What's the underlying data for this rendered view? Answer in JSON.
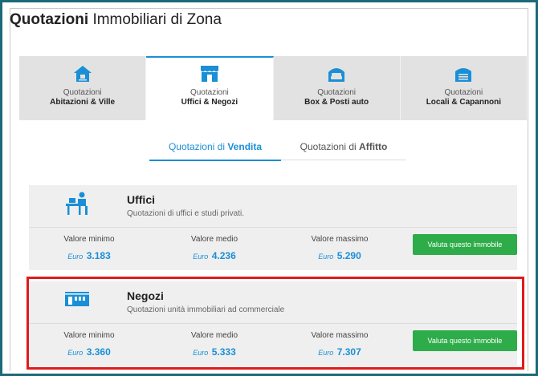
{
  "page": {
    "title_bold": "Quotazioni",
    "title_rest": "Immobiliari di Zona"
  },
  "category_tabs": [
    {
      "line1": "Quotazioni",
      "line2": "Abitazioni & Ville",
      "icon": "house-icon",
      "active": false
    },
    {
      "line1": "Quotazioni",
      "line2": "Uffici & Negozi",
      "icon": "shop-icon",
      "active": true
    },
    {
      "line1": "Quotazioni",
      "line2": "Box & Posti auto",
      "icon": "car-garage-icon",
      "active": false
    },
    {
      "line1": "Quotazioni",
      "line2": "Locali & Capannoni",
      "icon": "warehouse-icon",
      "active": false
    }
  ],
  "sub_tabs": {
    "vendita_prefix": "Quotazioni di",
    "vendita_bold": "Vendita",
    "affitto_prefix": "Quotazioni di",
    "affitto_bold": "Affitto"
  },
  "cards": [
    {
      "title": "Uffici",
      "description": "Quotazioni di uffici e studi privati.",
      "icon": "office-desk-icon",
      "min_label": "Valore minimo",
      "min_currency": "Euro",
      "min_value": "3.183",
      "avg_label": "Valore medio",
      "avg_currency": "Euro",
      "avg_value": "4.236",
      "max_label": "Valore massimo",
      "max_currency": "Euro",
      "max_value": "5.290",
      "button": "Valuta questo immobile"
    },
    {
      "title": "Negozi",
      "description": "Quotazioni unità immobiliari ad commerciale",
      "icon": "storefront-icon",
      "min_label": "Valore minimo",
      "min_currency": "Euro",
      "min_value": "3.360",
      "avg_label": "Valore medio",
      "avg_currency": "Euro",
      "avg_value": "5.333",
      "max_label": "Valore massimo",
      "max_currency": "Euro",
      "max_value": "7.307",
      "button": "Valuta questo immobile"
    }
  ],
  "colors": {
    "accent_blue": "#1a8fd6",
    "button_green": "#2eac4a",
    "highlight_red": "#e01a1a",
    "frame_teal": "#1c6a78"
  }
}
